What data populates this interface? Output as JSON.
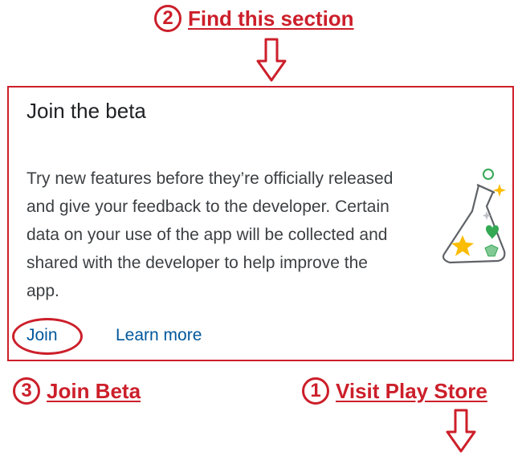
{
  "annotations": {
    "step2": {
      "number": "2",
      "label": "Find this section"
    },
    "step3": {
      "number": "3",
      "label": "Join Beta"
    },
    "step1": {
      "number": "1",
      "label": "Visit Play Store"
    },
    "color": "#cc1f2a"
  },
  "card": {
    "title": "Join the beta",
    "body": "Try new features before they’re officially released and give your feedback to the developer. Certain data on your use of the app will be collected and shared with the developer to help improve the app.",
    "join_label": "Join",
    "learn_more_label": "Learn more",
    "illustration": "beta-flask-icon",
    "link_color": "#01579b"
  }
}
